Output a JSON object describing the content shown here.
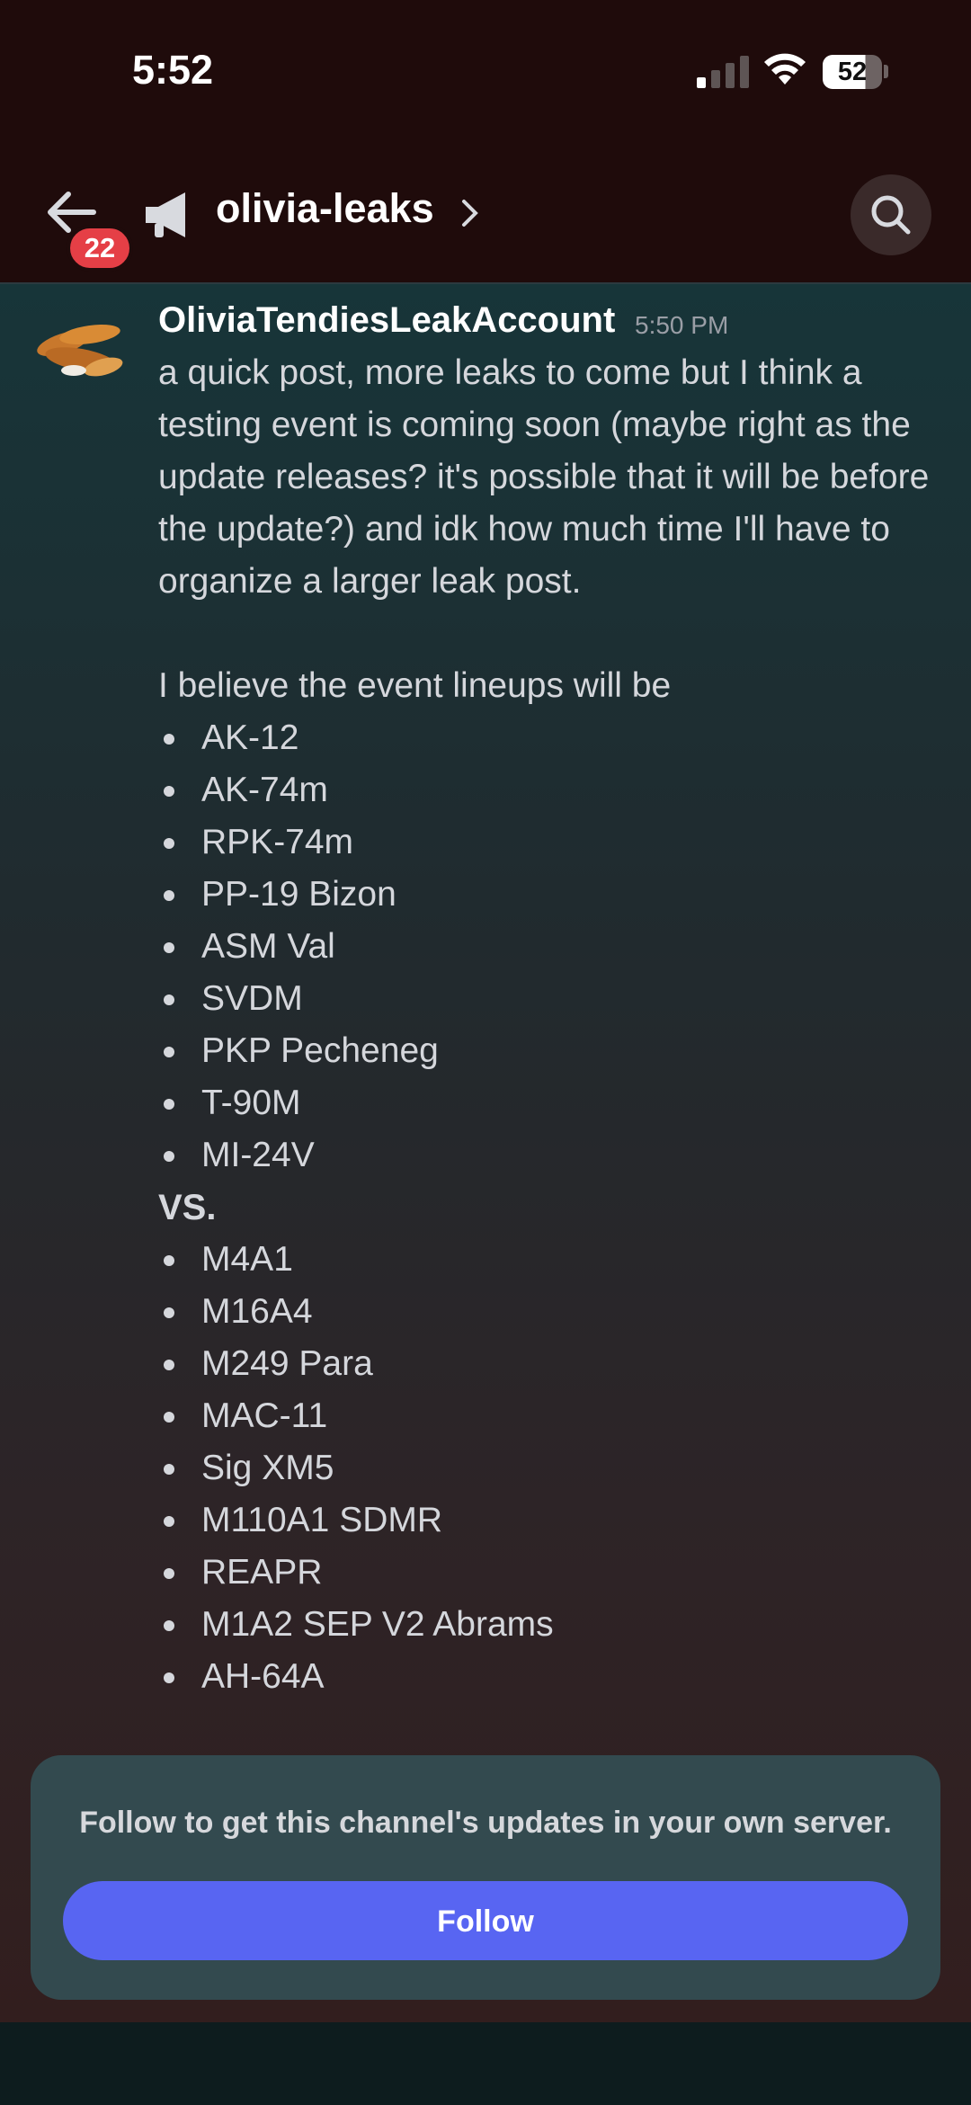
{
  "status_bar": {
    "time": "5:52",
    "battery": "52"
  },
  "header": {
    "unread_badge": "22",
    "channel_name": "olivia-leaks"
  },
  "message": {
    "author": "OliviaTendiesLeakAccount",
    "timestamp": "5:50 PM",
    "intro": "a quick post, more leaks to come but I think a testing event is coming soon (maybe right as the update releases? it's possible that it will be before the update?) and idk how much time I'll have to organize a larger leak post.",
    "lineup_intro": "I believe the event lineups will be",
    "team_a": [
      "AK-12",
      "AK-74m",
      "RPK-74m",
      "PP-19 Bizon",
      "ASM Val",
      "SVDM",
      "PKP Pecheneg",
      "T-90M",
      "MI-24V"
    ],
    "versus": "VS.",
    "team_b": [
      "M4A1",
      "M16A4",
      "M249 Para",
      "MAC-11",
      "Sig XM5",
      "M110A1 SDMR",
      "REAPR",
      "M1A2 SEP V2 Abrams",
      "AH-64A"
    ]
  },
  "follow_card": {
    "text": "Follow to get this channel's updates in your own server.",
    "button_label": "Follow"
  },
  "colors": {
    "accent": "#5865f2",
    "badge": "#e53f46",
    "header_bg": "#1f0b0b"
  },
  "icons": [
    "signal-icon",
    "wifi-icon",
    "battery-icon",
    "back-arrow-icon",
    "megaphone-icon",
    "chevron-right-icon",
    "search-icon",
    "avatar-chicken-tenders"
  ]
}
